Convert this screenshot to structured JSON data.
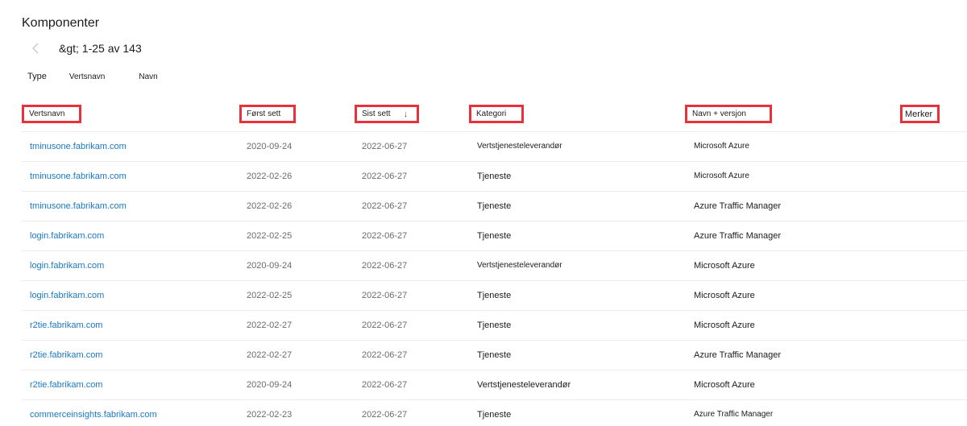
{
  "page": {
    "title": "Komponenter"
  },
  "pager": {
    "text": "&gt; 1-25 av 143"
  },
  "filters": {
    "type_label": "Type",
    "host_label": "Vertsnavn",
    "name_label": "Navn"
  },
  "table": {
    "headers": {
      "host": "Vertsnavn",
      "first_seen": "Først sett",
      "last_seen": "Sist sett",
      "category": "Kategori",
      "name_version": "Navn + versjon",
      "tags": "Merker"
    },
    "rows": [
      {
        "host": "tminusone.fabrikam.com",
        "first": "2020-09-24",
        "last": "2022-06-27",
        "category": "Vertstjenesteleverandør",
        "name": "Microsoft Azure"
      },
      {
        "host": "tminusone.fabrikam.com",
        "first": "2022-02-26",
        "last": "2022-06-27",
        "category": "Tjeneste",
        "name": "Microsoft Azure"
      },
      {
        "host": "tminusone.fabrikam.com",
        "first": "2022-02-26",
        "last": "2022-06-27",
        "category": "Tjeneste",
        "name": "Azure Traffic Manager"
      },
      {
        "host": "login.fabrikam.com",
        "first": "2022-02-25",
        "last": "2022-06-27",
        "category": "Tjeneste",
        "name": "Azure Traffic Manager"
      },
      {
        "host": "login.fabrikam.com",
        "first": "2020-09-24",
        "last": "2022-06-27",
        "category": "Vertstjenesteleverandør",
        "name": "Microsoft Azure"
      },
      {
        "host": "login.fabrikam.com",
        "first": "2022-02-25",
        "last": "2022-06-27",
        "category": "Tjeneste",
        "name": "Microsoft Azure"
      },
      {
        "host": "r2tie.fabrikam.com",
        "first": "2022-02-27",
        "last": "2022-06-27",
        "category": "Tjeneste",
        "name": "Microsoft Azure"
      },
      {
        "host": "r2tie.fabrikam.com",
        "first": "2022-02-27",
        "last": "2022-06-27",
        "category": "Tjeneste",
        "name": "Azure Traffic Manager"
      },
      {
        "host": "r2tie.fabrikam.com",
        "first": "2020-09-24",
        "last": "2022-06-27",
        "category": "Vertstjenesteleverandør",
        "name": "Microsoft Azure"
      },
      {
        "host": "commerceinsights.fabrikam.com",
        "first": "2022-02-23",
        "last": "2022-06-27",
        "category": "Tjeneste",
        "name": "Azure Traffic Manager"
      }
    ]
  },
  "colors": {
    "link": "#1a78c2",
    "highlight_border": "#e8313a",
    "muted_text": "#6b6b6b"
  },
  "icons": {
    "pager_prev": "chevron-left-icon",
    "sort": "arrow-down-icon"
  }
}
